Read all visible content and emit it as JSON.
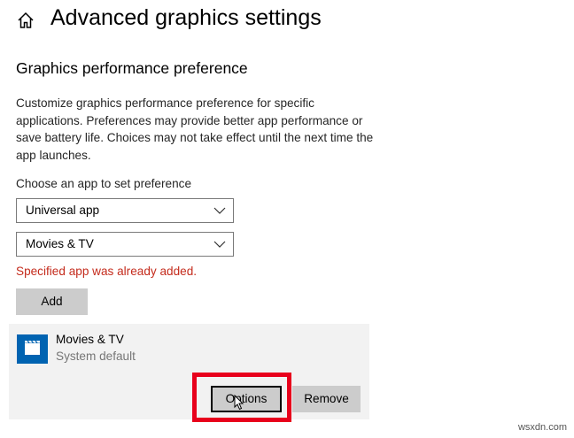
{
  "header": {
    "home_icon": "home-icon",
    "title": "Advanced graphics settings"
  },
  "section": {
    "title": "Graphics performance preference",
    "description": "Customize graphics performance preference for specific applications. Preferences may provide better app performance or save battery life. Choices may not take effect until the next time the app launches."
  },
  "chooser": {
    "label": "Choose an app to set preference",
    "app_type_value": "Universal app",
    "app_value": "Movies & TV",
    "error": "Specified app was already added.",
    "add_label": "Add"
  },
  "app_entry": {
    "icon": "clapperboard-icon",
    "name": "Movies & TV",
    "preference": "System default",
    "options_label": "Options",
    "remove_label": "Remove"
  },
  "watermark": "wsxdn.com",
  "colors": {
    "accent": "#0063b1",
    "error": "#c42b1c",
    "highlight": "#e8001c",
    "button": "#cccccc",
    "card": "#f2f2f2"
  }
}
